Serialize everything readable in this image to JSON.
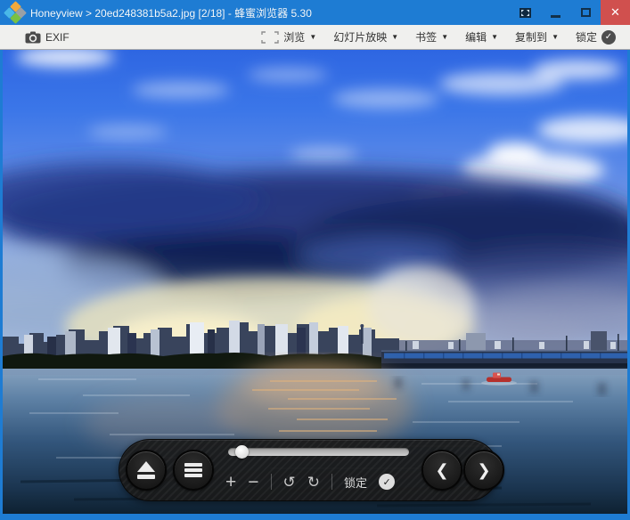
{
  "window": {
    "title_full": "Honeyview > 20ed248381b5a2.jpg [2/18] - 蜂蜜浏览器 5.30",
    "app_name": "Honeyview",
    "filename": "20ed248381b5a2.jpg",
    "image_index": "[2/18]",
    "app_name_cn": "蜂蜜浏览器",
    "version": "5.30",
    "close_glyph": "✕"
  },
  "toolbar": {
    "exif_label": "EXIF",
    "menus": [
      {
        "label": "浏览",
        "has_dropdown": true,
        "leading_icon": "fit-to-window-icon"
      },
      {
        "label": "幻灯片放映",
        "has_dropdown": true
      },
      {
        "label": "书签",
        "has_dropdown": true
      },
      {
        "label": "编辑",
        "has_dropdown": true
      },
      {
        "label": "复制到",
        "has_dropdown": true
      }
    ],
    "lock": {
      "label": "锁定",
      "checked": true
    }
  },
  "icons": {
    "dropdown": "▼",
    "check": "✓",
    "plus": "+",
    "minus": "−",
    "rotate_left": "↺",
    "rotate_right": "↻",
    "prev": "❮",
    "next": "❯"
  },
  "viewer": {
    "photo_description": "Dramatic blue clouded sky over a riverside city skyline with tower, long bridge at right, sunset glow reflecting on the water, small red boat near the bridge"
  },
  "controlbar": {
    "slider_percent": 7,
    "lock_label": "锁定",
    "lock_checked": true
  },
  "colors": {
    "titlebar": "#1e7cd3",
    "close_button": "#d0504e",
    "toolbar_bg": "#f0f0ee",
    "sky_top": "#2e66e2",
    "storm_cloud": "#1d2f73",
    "sunset_glow": "#f2e8bc",
    "water_dark": "#10222f",
    "boat_red": "#b5302c"
  }
}
